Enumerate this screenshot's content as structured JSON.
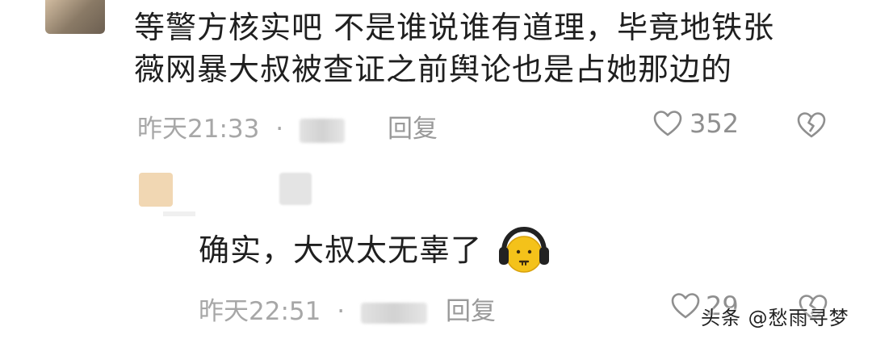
{
  "comments": [
    {
      "text_lines": [
        "等警方核实吧 不是谁说谁有道理，毕竟地铁张",
        "薇网暴大叔被查证之前舆论也是占她那边的"
      ],
      "time": "昨天21:33",
      "separator": "·",
      "reply_label": "回复",
      "like_count": "352",
      "icons": {
        "like": "heart-outline-icon",
        "dislike": "broken-heart-icon"
      }
    },
    {
      "text": "确实，大叔太无辜了",
      "emoji": "headphones-face-emoji",
      "time": "昨天22:51",
      "separator": "·",
      "reply_label": "回复",
      "like_count": "29",
      "icons": {
        "like": "heart-outline-icon",
        "dislike": "broken-heart-icon"
      }
    }
  ],
  "watermark": "头条 @愁雨寻梦",
  "colors": {
    "meta_gray": "#a7a7a7",
    "text": "#1f1f1f",
    "icon_gray": "#8f8f8f"
  }
}
